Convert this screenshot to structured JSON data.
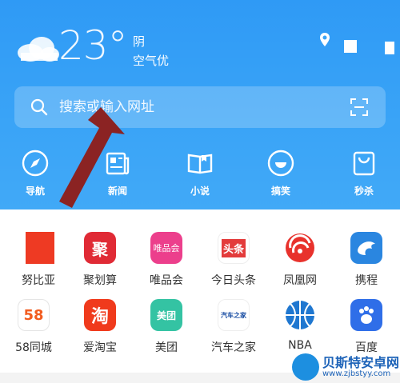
{
  "weather": {
    "temperature": "23°",
    "condition": "阴",
    "air_quality": "空气优",
    "icon": "cloud-icon"
  },
  "header_icons": [
    "location-pin-icon",
    "square-icon"
  ],
  "search": {
    "placeholder": "搜索或输入网址",
    "icon": "search-icon",
    "scan_icon": "scan-icon"
  },
  "nav": [
    {
      "label": "导航",
      "icon": "compass-icon"
    },
    {
      "label": "新闻",
      "icon": "newspaper-icon"
    },
    {
      "label": "小说",
      "icon": "book-icon"
    },
    {
      "label": "搞笑",
      "icon": "smiley-icon"
    },
    {
      "label": "秒杀",
      "icon": "shopping-bag-icon"
    }
  ],
  "apps": [
    {
      "name": "努比亚",
      "icon_text": ""
    },
    {
      "name": "聚划算",
      "icon_text": "聚"
    },
    {
      "name": "唯品会",
      "icon_text": "唯品会"
    },
    {
      "name": "今日头条",
      "icon_text": "头条"
    },
    {
      "name": "凤凰网",
      "icon_text": ""
    },
    {
      "name": "携程",
      "icon_text": ""
    },
    {
      "name": "58同城",
      "icon_text": "58"
    },
    {
      "name": "爱淘宝",
      "icon_text": "淘"
    },
    {
      "name": "美团",
      "icon_text": "美团"
    },
    {
      "name": "汽车之家",
      "icon_text": "汽车之家"
    },
    {
      "name": "NBA",
      "icon_text": "NBA"
    },
    {
      "name": "百度",
      "icon_text": "du"
    }
  ],
  "watermark": {
    "title": "贝斯特安卓网",
    "url": "www.zjbstyy.com"
  },
  "colors": {
    "header_bg": "#3aa4f7",
    "arrow": "#8b2323"
  }
}
